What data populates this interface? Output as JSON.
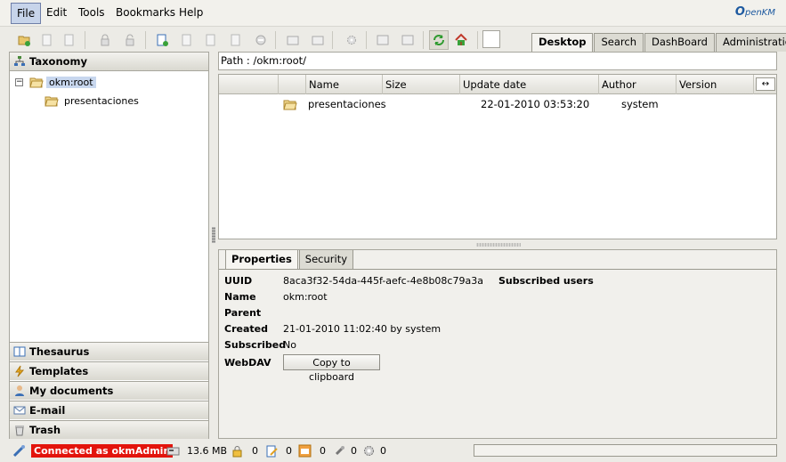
{
  "menubar": {
    "items": [
      "File",
      "Edit",
      "Tools",
      "Bookmarks",
      "Help"
    ],
    "active": "File",
    "logo_main": "penKM",
    "logo_prefix": "O"
  },
  "tabs": [
    "Desktop",
    "Search",
    "DashBoard",
    "Administration"
  ],
  "active_tab": "Desktop",
  "sidebar": {
    "header": "Taxonomy",
    "tree": {
      "root_label": "okm:root",
      "children": [
        "presentaciones"
      ]
    },
    "panels": [
      "Thesaurus",
      "Templates",
      "My documents",
      "E-mail",
      "Trash"
    ]
  },
  "path": {
    "label": "Path : /okm:root/"
  },
  "filelist": {
    "columns": [
      "Name",
      "Size",
      "Update date",
      "Author",
      "Version"
    ],
    "rows": [
      {
        "name": "presentaciones",
        "size": "",
        "updated": "22-01-2010 03:53:20",
        "author": "system",
        "version": ""
      }
    ]
  },
  "properties": {
    "tabs": [
      "Properties",
      "Security"
    ],
    "active_tab": "Properties",
    "fields": {
      "uuid_label": "UUID",
      "uuid": "8aca3f32-54da-445f-aefc-4e8b08c79a3a",
      "name_label": "Name",
      "name": "okm:root",
      "parent_label": "Parent",
      "parent": "",
      "created_label": "Created",
      "created": "21-01-2010 11:02:40 by system",
      "subscribed_label": "Subscribed",
      "subscribed": "No",
      "webdav_label": "WebDAV",
      "copy_button": "Copy to clipboard"
    },
    "subscribed_users_label": "Subscribed users"
  },
  "status": {
    "connected": "Connected as okmAdmin",
    "repo_size": "13.6 MB",
    "locked_count": "0",
    "checkout_count": "0",
    "mail_count": "0",
    "subscriptions_count": "0",
    "workflow_count": "0"
  },
  "colors": {
    "background": "#ecebe6",
    "connected_bg": "#e3140c",
    "selected_bg": "#c8d7ee",
    "logo": "#1e5aa0"
  }
}
